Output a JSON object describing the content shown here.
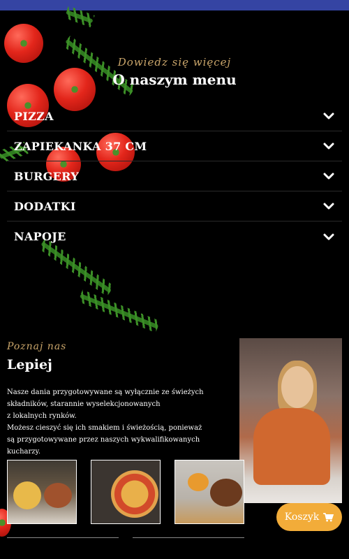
{
  "menu_section": {
    "script_heading": "Dowiedz się więcej",
    "title": "O naszym menu",
    "items": [
      {
        "label": "PIZZA"
      },
      {
        "label": "ZAPIEKANKA 37 CM"
      },
      {
        "label": "BURGERY"
      },
      {
        "label": "DODATKI"
      },
      {
        "label": "NAPOJE"
      }
    ]
  },
  "about_section": {
    "script_heading": "Poznaj nas",
    "title": "Lepiej",
    "lines": [
      "Nasze dania przygotowywane są wyłącznie ze świeżych",
      "składników, starannie wyselekcjonowanych",
      "z lokalnych rynków.",
      "Możesz cieszyć się ich smakiem i świeżością, ponieważ",
      "są przygotowywane przez naszych wykwalifikowanych kucharzy."
    ]
  },
  "cart_button": {
    "label": "Koszyk",
    "icon": "cart-icon"
  },
  "colors": {
    "accent": "#f2ac39",
    "script_gold": "#c9a56a",
    "top_bar": "#3544a3",
    "background": "#000000"
  }
}
